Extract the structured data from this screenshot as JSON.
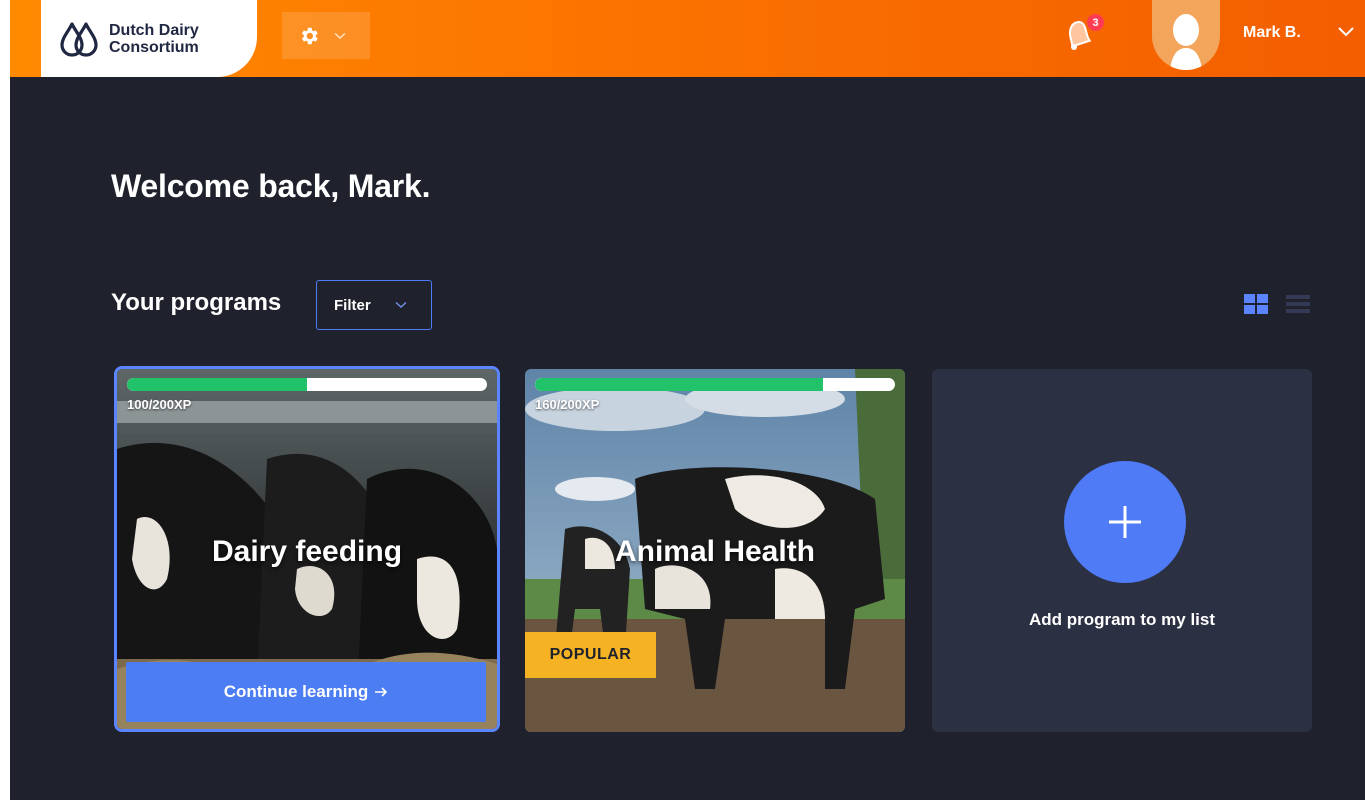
{
  "brand": {
    "line1": "Dutch Dairy",
    "line2": "Consortium"
  },
  "notifications": {
    "count": "3"
  },
  "user": {
    "name": "Mark B."
  },
  "main": {
    "welcome": "Welcome back, Mark.",
    "programs_title": "Your programs",
    "filter_label": "Filter"
  },
  "programs": [
    {
      "title": "Dairy feeding",
      "xp_label": "100/200XP",
      "xp_current": 100,
      "xp_total": 200,
      "action": "Continue learning",
      "selected": true
    },
    {
      "title": "Animal Health",
      "xp_label": "160/200XP",
      "xp_current": 160,
      "xp_total": 200,
      "badge": "POPULAR",
      "selected": false
    }
  ],
  "add_card": {
    "label": "Add program to my list"
  },
  "icons": {
    "logo": "milk-drop-logo-icon",
    "settings": "gear-icon",
    "notifications": "bell-icon",
    "avatar": "user-silhouette-icon",
    "grid": "grid-view-icon",
    "list": "list-view-icon",
    "add": "plus-icon",
    "arrow": "arrow-right-icon"
  },
  "colors": {
    "background": "#1f222c",
    "topbar_start": "#ff8a00",
    "topbar_end": "#f35e00",
    "accent_blue": "#4f7bf6",
    "progress_green": "#22c26a",
    "badge_yellow": "#f5b324",
    "notification_red": "#ff3b52",
    "add_card_bg": "#2c3043"
  }
}
